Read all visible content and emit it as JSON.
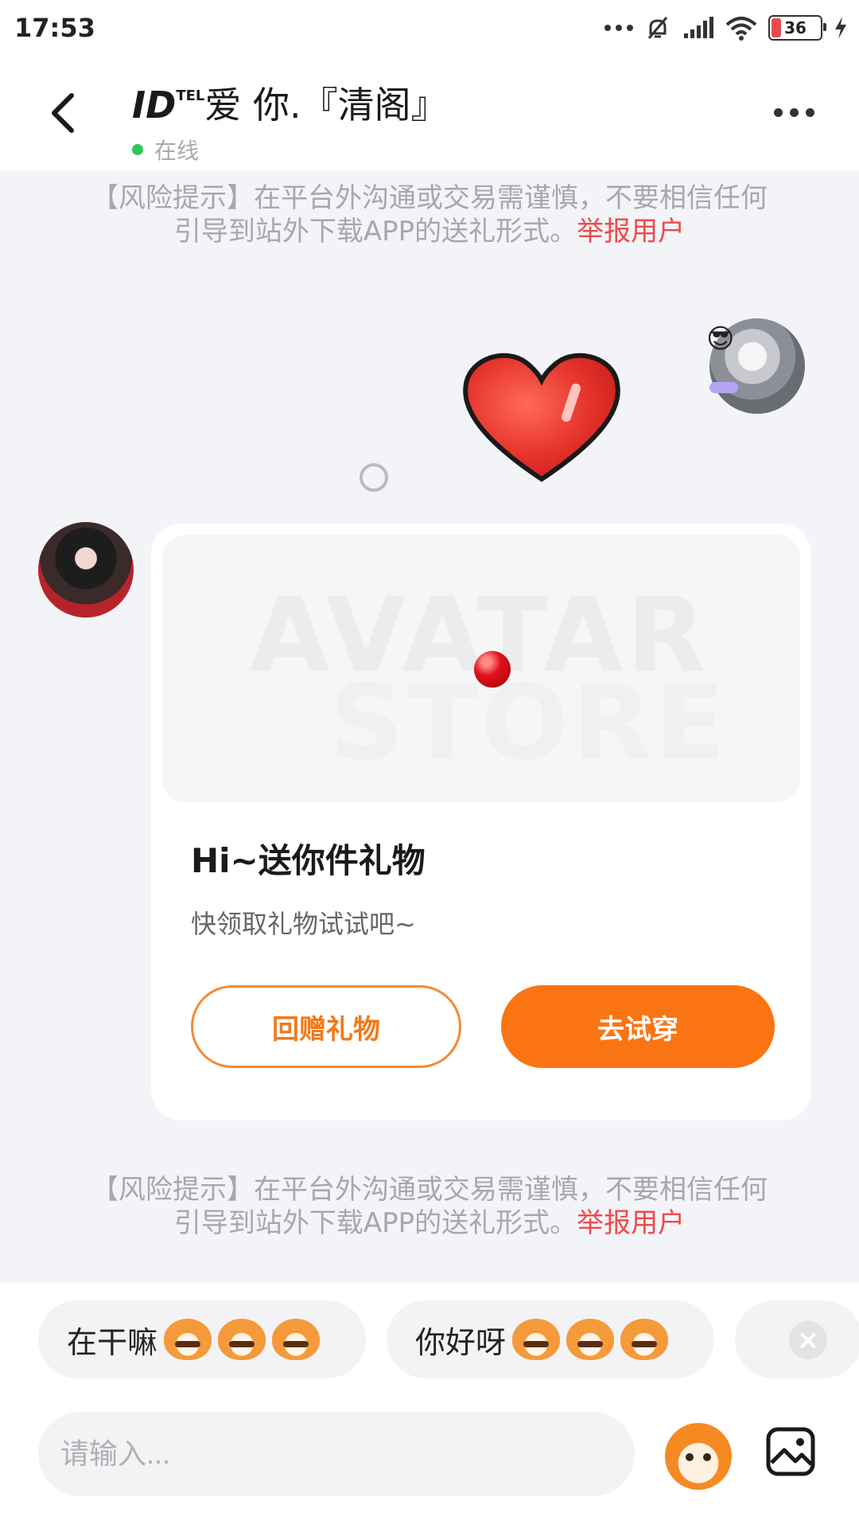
{
  "status_bar": {
    "time": "17:53",
    "icons": [
      "more-dots-icon",
      "mute-icon",
      "signal-icon",
      "wifi-icon",
      "battery-icon",
      "charging-icon"
    ],
    "battery_level": "36"
  },
  "header": {
    "title_id": "ID",
    "title_sup": "TEL",
    "title_text": "爱 你.『清阁』",
    "status_text": "在线",
    "status_color": "#33c45b"
  },
  "risk_notice": {
    "line1": "【风险提示】在平台外沟通或交易需谨慎，不要相信任何",
    "line2": "引导到站外下载APP的送礼形式。",
    "report_link": "举报用户"
  },
  "gift_card": {
    "watermark_line1": "AVATAR",
    "watermark_line2": "STORE",
    "title": "Hi~送你件礼物",
    "subtitle": "快领取礼物试试吧~",
    "return_gift_label": "回赠礼物",
    "try_on_label": "去试穿",
    "accent_color": "#fb7413"
  },
  "quick_replies": [
    {
      "text": "在干嘛"
    },
    {
      "text": "你好呀"
    }
  ],
  "composer": {
    "placeholder": "请输入..."
  }
}
